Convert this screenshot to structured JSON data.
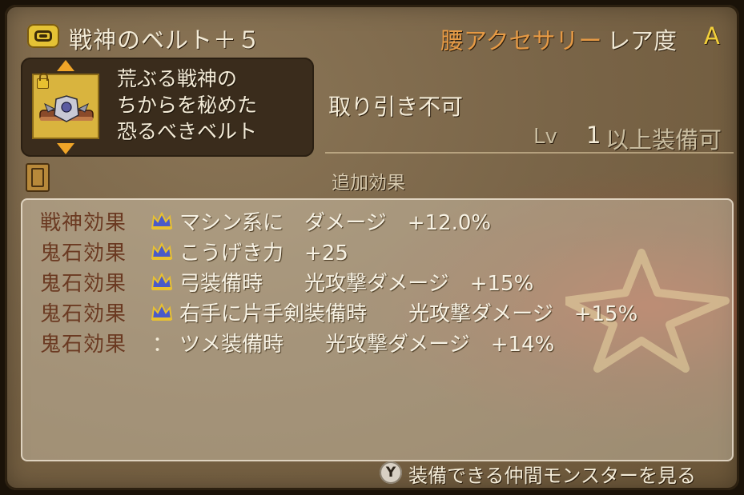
{
  "header": {
    "item_name": "戦神のベルト＋５",
    "category": "腰アクセサリー",
    "rarity_label": "レア度",
    "rarity_value": "A"
  },
  "description": {
    "text": "荒ぶる戦神の\nちからを秘めた\n恐るべきベルト"
  },
  "info": {
    "trade": "取り引き不可",
    "lv_label": "Lv",
    "lv_value": "1",
    "lv_suffix": "以上装備可"
  },
  "effects": {
    "section_title": "追加効果",
    "rows": [
      {
        "label": "戦神効果",
        "icon": "crown-icon",
        "text": "マシン系に　ダメージ　+12.0%"
      },
      {
        "label": "鬼石効果",
        "icon": "crown-icon",
        "text": "こうげき力　+25"
      },
      {
        "label": "鬼石効果",
        "icon": "crown-icon",
        "text": "弓装備時　　光攻撃ダメージ　+15%"
      },
      {
        "label": "鬼石効果",
        "icon": "crown-icon",
        "text": "右手に片手剣装備時　　光攻撃ダメージ　+15%"
      },
      {
        "label": "鬼石効果",
        "icon": "colon",
        "colon": "：",
        "text": "ツメ装備時　　光攻撃ダメージ　+14%"
      }
    ]
  },
  "footer": {
    "button": "Y",
    "text": "装備できる仲間モンスターを見る"
  },
  "colors": {
    "accent_orange": "#e69a45",
    "rarity_gold": "#f3d03a",
    "effect_label_brown": "#6b3a22"
  }
}
